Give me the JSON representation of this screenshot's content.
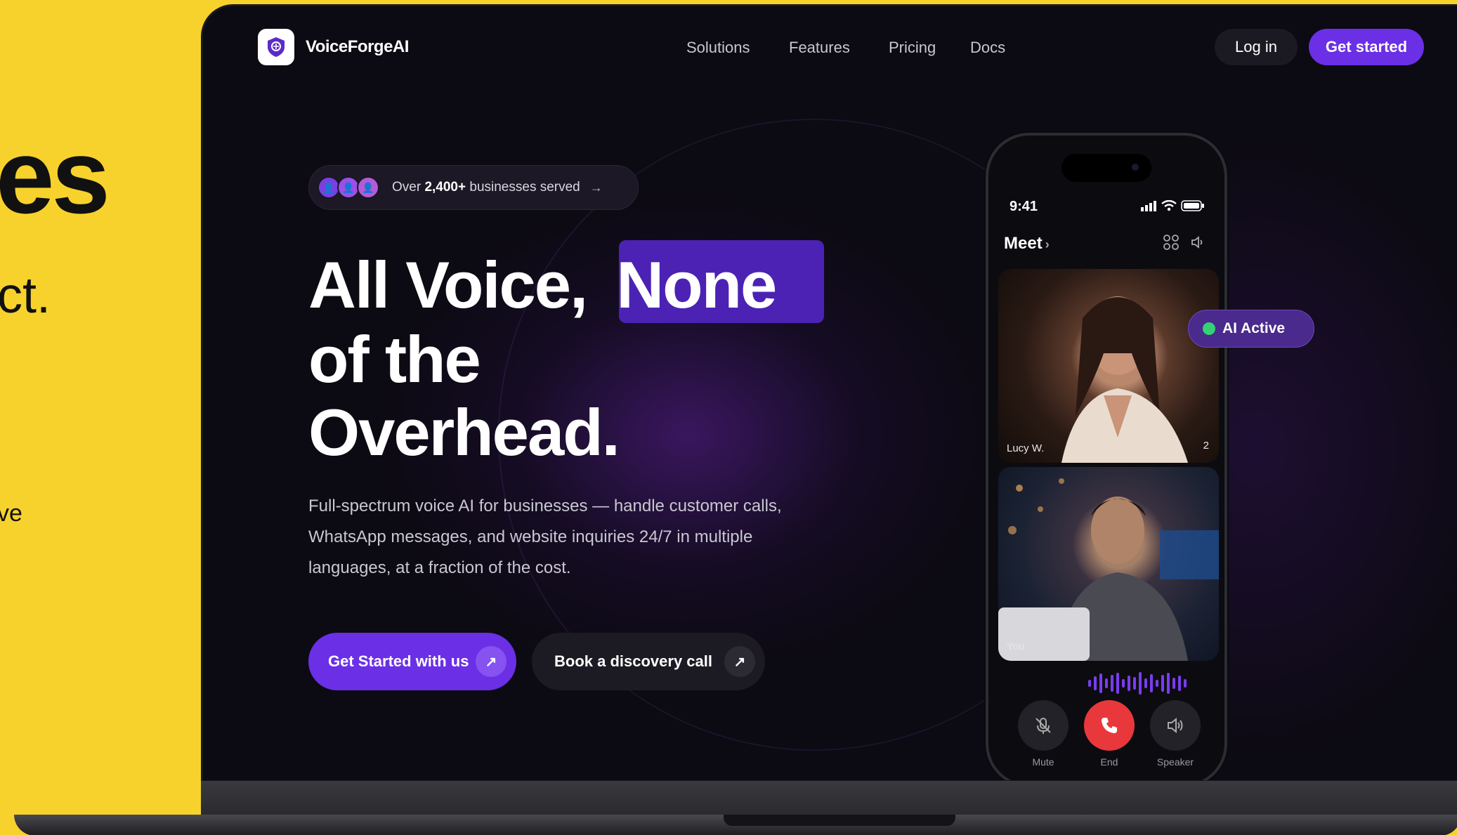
{
  "backdrop": {
    "fragment_title": "es",
    "fragment_line": "ct.",
    "fragment_small": "ve"
  },
  "nav": {
    "brand": "VoiceForgeAI",
    "links": [
      "Solutions",
      "Features",
      "Pricing",
      "Docs"
    ],
    "login": "Log in",
    "cta": "Get started"
  },
  "badge": {
    "prefix": "Over ",
    "count": "2,400+",
    "suffix": " businesses served",
    "arrow": "→"
  },
  "hero": {
    "line1": "All Voice,",
    "highlight": "None",
    "line2": "of the",
    "line3": "Overhead.",
    "subtitle": "Full-spectrum voice AI for businesses — handle customer calls, WhatsApp messages, and website inquiries 24/7 in multiple languages, at a fraction of the cost.",
    "primary_cta": "Get Started with us",
    "secondary_cta": "Book a discovery call"
  },
  "phone": {
    "time": "9:41",
    "app_title": "Meet",
    "participant1": "Lucy W.",
    "participant_count": "2",
    "participant2": "You",
    "ai_status": "AI Active",
    "controls": [
      "Mute",
      "End",
      "Speaker"
    ]
  },
  "colors": {
    "accent": "#6b2fe6",
    "highlight": "#4b22b4",
    "background": "#0c0a12",
    "backdrop": "#f7d22c",
    "end_call": "#e9383c",
    "ai_dot": "#34d274"
  },
  "icons": {
    "logo": "shield-icon",
    "badge_arrow": "arrow-right-icon",
    "cta_arrow": "arrow-up-right-icon",
    "signal": "signal-icon",
    "wifi": "wifi-icon",
    "battery": "battery-icon",
    "grid": "grid-icon",
    "volume": "volume-icon",
    "mute": "mic-off-icon",
    "end": "phone-icon",
    "speaker": "speaker-icon"
  }
}
